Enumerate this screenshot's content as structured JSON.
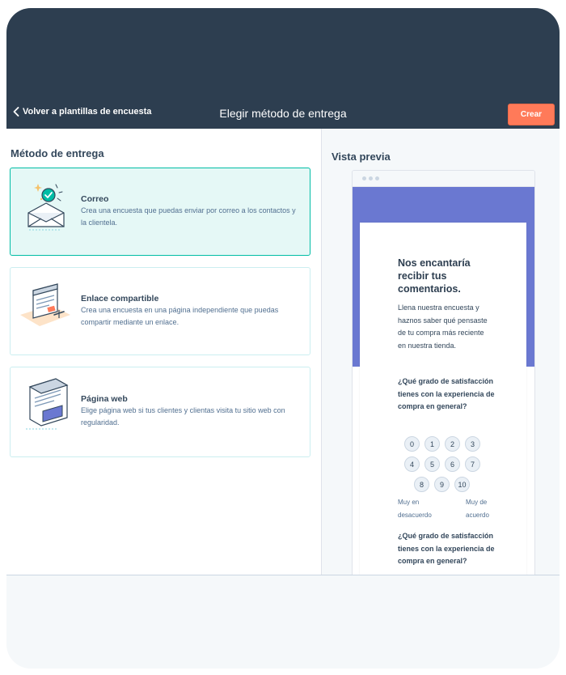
{
  "header": {
    "back_label": "Volver a plantillas de encuesta",
    "title": "Elegir método de entrega",
    "create_label": "Crear"
  },
  "colors": {
    "header_bg": "#2d3e50",
    "accent_orange": "#ff7a59",
    "selected_card_bg": "#e5f8f6",
    "preview_band": "#6a78d1"
  },
  "delivery": {
    "section_title": "Método de entrega",
    "options": [
      {
        "title": "Correo",
        "description": "Crea una encuesta que puedas enviar por correo a los contactos y la clientela.",
        "icon": "email-envelope-icon",
        "selected": true
      },
      {
        "title": "Enlace compartible",
        "description": "Crea una encuesta en una página independiente que puedas compartir mediante un enlace.",
        "icon": "shareable-link-page-icon",
        "selected": false
      },
      {
        "title": "Página web",
        "description": "Elige página web si tus clientes y clientas visita tu sitio web con regularidad.",
        "icon": "web-page-icon",
        "selected": false
      }
    ]
  },
  "preview": {
    "title": "Vista previa",
    "heading": "Nos encantaría recibir tus comentarios.",
    "intro": "Llena nuestra encuesta y haznos saber qué pensaste de tu compra más reciente en nuestra tienda.",
    "question1": "¿Qué grado de satisfacción tienes con la experiencia de compra en general?",
    "scale": [
      "0",
      "1",
      "2",
      "3",
      "4",
      "5",
      "6",
      "7",
      "8",
      "9",
      "10"
    ],
    "low_label": "Muy en desacuerdo",
    "high_label": "Muy de acuerdo",
    "question2": "¿Qué grado de satisfacción tienes con la experiencia de compra en general?"
  }
}
